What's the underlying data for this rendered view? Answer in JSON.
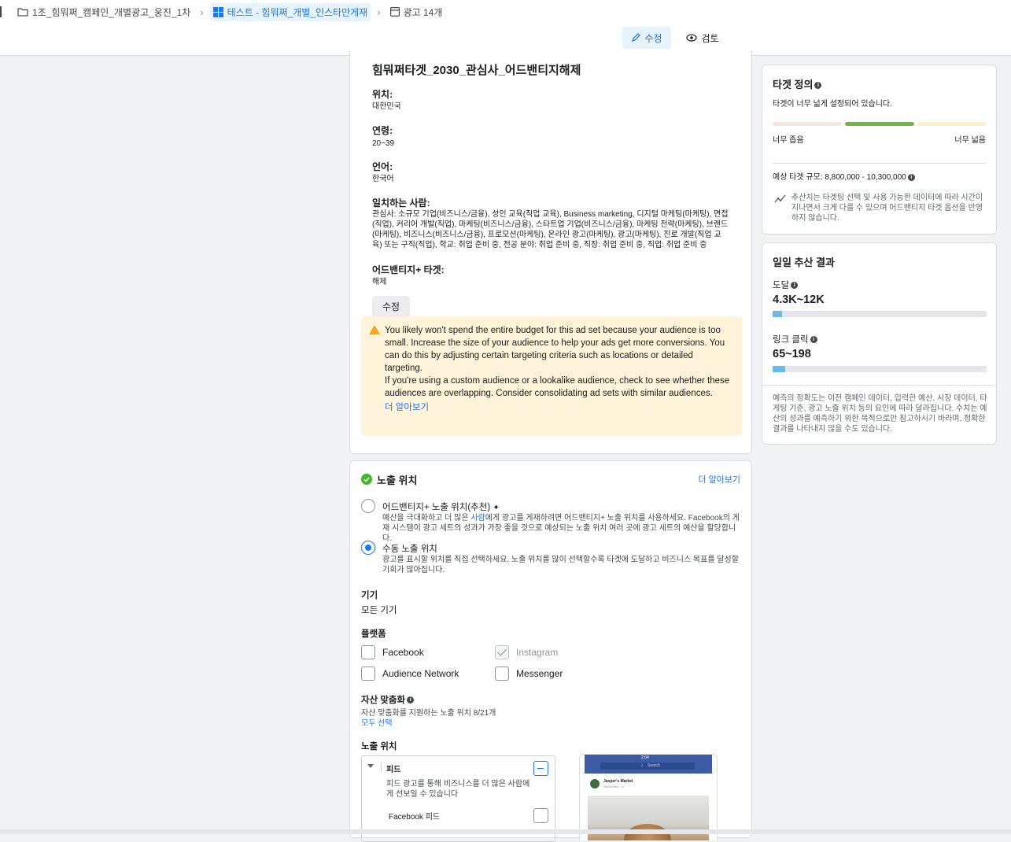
{
  "breadcrumbs": [
    {
      "label": "1조_힘뭐쩌_캠페인_개별광고_웅진_1차",
      "icon": "folder-icon"
    },
    {
      "label": "테스트 - 힘뭐쩌_개별_인스타만게재",
      "icon": "grid-icon"
    },
    {
      "label": "광고 14개",
      "icon": "ad-icon"
    }
  ],
  "toolbar": {
    "edit_label": "수정",
    "review_label": "검토"
  },
  "audience": {
    "title": "힘뭐쩌타겟_2030_관심사_어드밴티지해제",
    "location_label": "위치:",
    "location_value": "대한민국",
    "age_label": "연령:",
    "age_value": "20~39",
    "language_label": "언어:",
    "language_value": "한국어",
    "match_label": "일치하는 사람:",
    "match_value": "관심사: 소규모 기업(비즈니스/금융), 성인 교육(직업 교육), Business marketing, 디지털 마케팅(마케팅), 면접(직업), 커리어 개발(직업), 마케팅(비즈니스/금융), 스타트업 기업(비즈니스/금융), 마케팅 전략(마케팅), 브랜드(마케팅), 비즈니스(비즈니스/금융), 프로모션(마케팅), 온라인 광고(마케팅), 광고(마케팅), 진로 개발(직업 교육) 또는 구직(직업), 학교: 취업 준비 중, 전공 분야: 취업 준비 중, 직장: 취업 준비 중, 직업: 취업 준비 중",
    "advantage_label": "어드밴티지+ 타겟:",
    "advantage_value": "해제",
    "edit_button": "수정"
  },
  "warning": {
    "p1": "You likely won't spend the entire budget for this ad set because your audience is too small. Increase the size of your audience to help your ads get more conversions. You can do this by adjusting certain targeting criteria such as locations or detailed targeting.",
    "p2": "If you're using a custom audience or a lookalike audience, check to see whether these audiences are overlapping. Consider consolidating ad sets with similar audiences.",
    "link": "더 알아보기"
  },
  "placements": {
    "title": "노출 위치",
    "learn_more": "더 알아보기",
    "advantage_title": "어드밴티지+ 노출 위치(추천)",
    "advantage_desc_pre": "예산을 극대화하고 더 많은 ",
    "advantage_desc_link": "사람",
    "advantage_desc_post": "에게 광고를 게재하려면 어드밴티지+ 노출 위치를 사용하세요. Facebook의 게재 시스템이 광고 세트의 성과가 가장 좋을 것으로 예상되는 노출 위치 여러 곳에 광고 세트의 예산을 할당합니다.",
    "manual_title": "수동 노출 위치",
    "manual_desc": "광고를 표시할 위치를 직접 선택하세요. 노출 위치를 많이 선택할수록 타겟에 도달하고 비즈니스 목표를 달성할 기회가 많아집니다.",
    "device_label": "기기",
    "device_value": "모든 기기",
    "platform_label": "플랫폼",
    "platforms": [
      "Facebook",
      "Instagram",
      "Audience Network",
      "Messenger"
    ],
    "asset_label": "자산 맞춤화",
    "asset_desc": "자산 맞춤화를 지원하는 노출 위치 8/21개",
    "select_all": "모두 선택",
    "placement_label": "노출 위치",
    "feed_title": "피드",
    "feed_desc": "피드 광고를 통해 비즈니스를 더 많은 사람에게 선보일 수 있습니다",
    "fb_feed": "Facebook 피드",
    "preview_time": "2:04",
    "preview_search": "Search",
    "preview_page": "Jasper's Market",
    "preview_sponsored": "Sponsored · ◎"
  },
  "target_def": {
    "title": "타겟 정의",
    "status": "타겟이 너무 넓게 설정되어 있습니다.",
    "narrow": "너무 좁음",
    "broad": "너무 넓음",
    "size_label": "예상 타겟 규모: 8,800,000 - 10,300,000",
    "note": "추산치는 타겟팅 선택 및 사용 가능한 데이터에 따라 시간이 지나면서 크게 다를 수 있으며 어드밴티지 타겟 옵션을 반영하지 않습니다."
  },
  "daily": {
    "title": "일일 추산 결과",
    "reach_label": "도달",
    "reach_value": "4.3K~12K",
    "reach_fill": 0.045,
    "clicks_label": "링크 클릭",
    "clicks_value": "65~198",
    "clicks_fill": 0.06,
    "note": "예측의 정확도는 이전 캠페인 데이터, 입력한 예산, 시장 데이터, 타게팅 기준, 광고 노출 위치 등의 요인에 따라 달라집니다. 수치는 예산의 성과를 예측하기 위한 목적으로만 참고하시기 바라며, 정확한 결과를 나타내지 않을 수도 있습니다."
  },
  "colors": {
    "accent": "#1877f2",
    "warning_bg": "#fff3d9",
    "meter_green": "#6fb840",
    "reach_bar": "#6bbbe8"
  }
}
